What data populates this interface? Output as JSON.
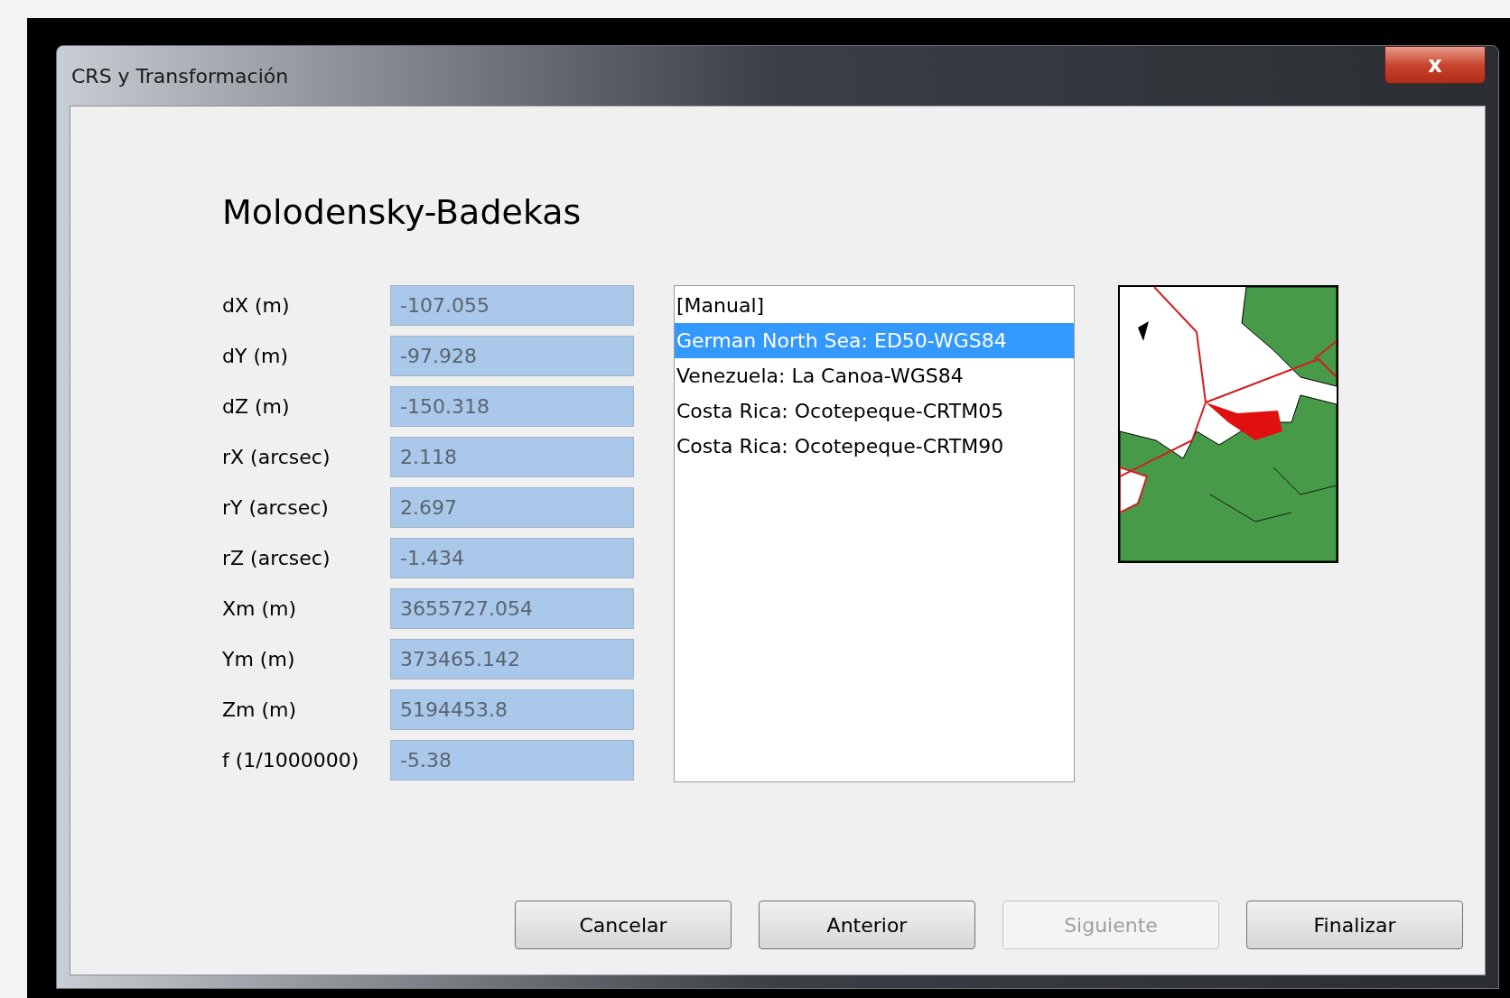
{
  "window": {
    "title": "CRS y Transformación",
    "close": "x"
  },
  "heading": "Molodensky-Badekas",
  "parameters": [
    {
      "label": "dX (m)",
      "value": "-107.055"
    },
    {
      "label": "dY (m)",
      "value": "-97.928"
    },
    {
      "label": "dZ (m)",
      "value": "-150.318"
    },
    {
      "label": "rX (arcsec)",
      "value": "2.118"
    },
    {
      "label": "rY (arcsec)",
      "value": "2.697"
    },
    {
      "label": "rZ (arcsec)",
      "value": "-1.434"
    },
    {
      "label": "Xm (m)",
      "value": "3655727.054"
    },
    {
      "label": "Ym (m)",
      "value": "373465.142"
    },
    {
      "label": "Zm (m)",
      "value": "5194453.8"
    },
    {
      "label": "f (1/1000000)",
      "value": "-5.38"
    }
  ],
  "transformations": [
    {
      "label": "[Manual]",
      "selected": false
    },
    {
      "label": "German North Sea: ED50-WGS84",
      "selected": true
    },
    {
      "label": "Venezuela: La Canoa-WGS84",
      "selected": false
    },
    {
      "label": "Costa Rica: Ocotepeque-CRTM05",
      "selected": false
    },
    {
      "label": "Costa Rica: Ocotepeque-CRTM90",
      "selected": false
    }
  ],
  "buttons": [
    {
      "label": "Cancelar",
      "disabled": false
    },
    {
      "label": "Anterior",
      "disabled": false
    },
    {
      "label": "Siguiente",
      "disabled": true
    },
    {
      "label": "Finalizar",
      "disabled": false
    }
  ]
}
